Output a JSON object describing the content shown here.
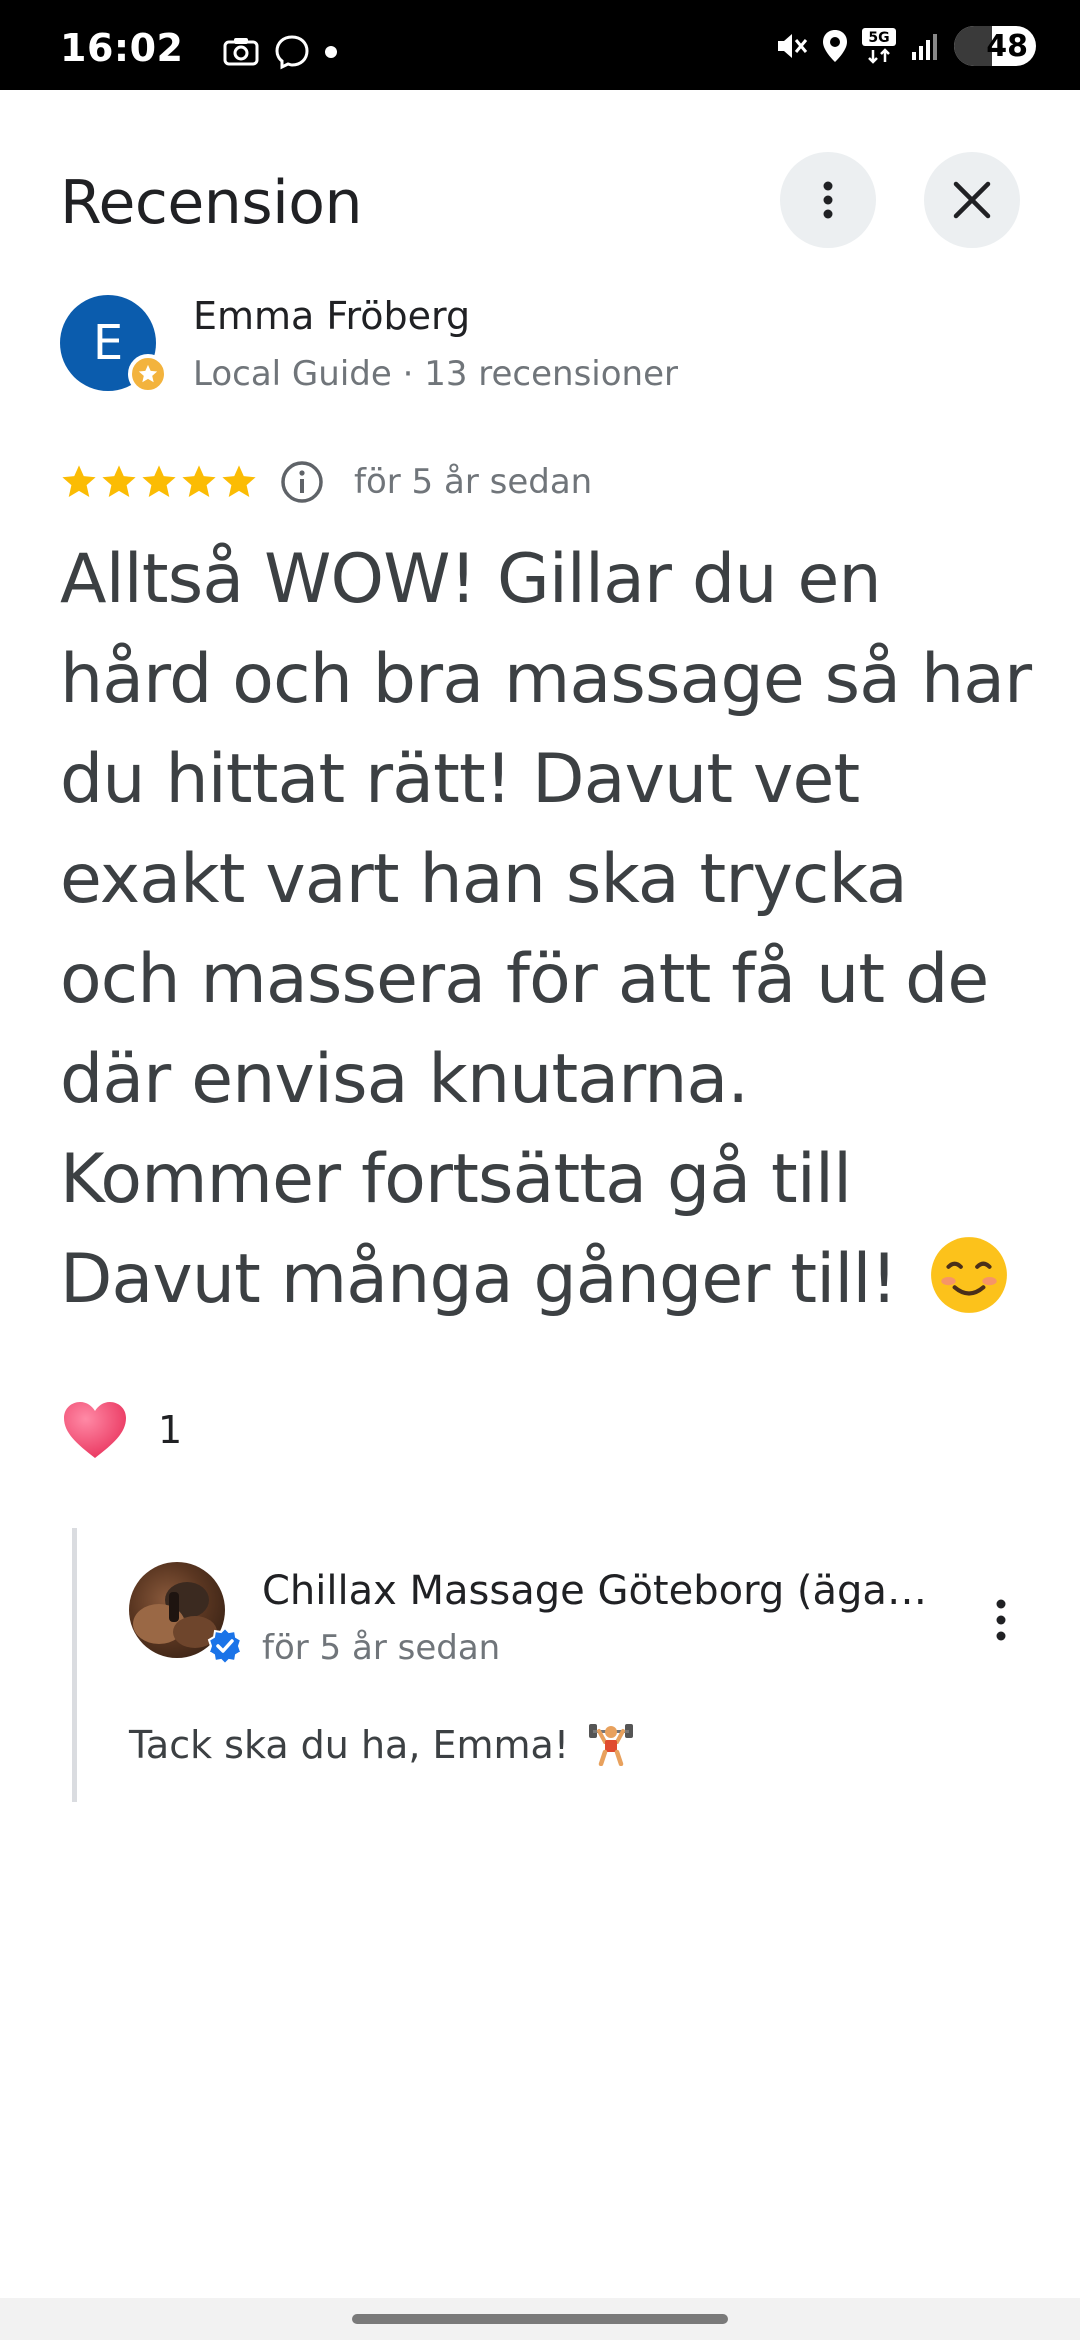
{
  "status_bar": {
    "time": "16:02",
    "battery": "48",
    "network": "5G"
  },
  "header": {
    "title": "Recension"
  },
  "review": {
    "avatar_initial": "E",
    "reviewer_name": "Emma Fröberg",
    "reviewer_meta": "Local Guide · 13 recensioner",
    "rating": 5,
    "max_rating": 5,
    "date": "för 5 år sedan",
    "text": "Alltså WOW! Gillar du en hård och bra massage så har du hittat rätt! Davut vet exakt vart han ska trycka och massera för att få ut de där envisa knutarna. Kommer fortsätta gå till Davut många gånger till!",
    "reaction_count": "1"
  },
  "owner_reply": {
    "name": "Chillax Massage Göteborg (äga…",
    "date": "för 5 år sedan",
    "text": "Tack ska du ha, Emma!"
  },
  "colors": {
    "star": "#fbbc04",
    "avatar": "#0b5cad",
    "verified": "#1a73e8",
    "heart": "#f0406a"
  },
  "icons": [
    "camera-icon",
    "messenger-icon",
    "mute-icon",
    "location-icon",
    "signal-icon",
    "more-vert-icon",
    "close-icon",
    "star-icon",
    "info-icon",
    "heart-icon",
    "smiling-face-icon",
    "weightlifter-icon",
    "verified-icon"
  ]
}
